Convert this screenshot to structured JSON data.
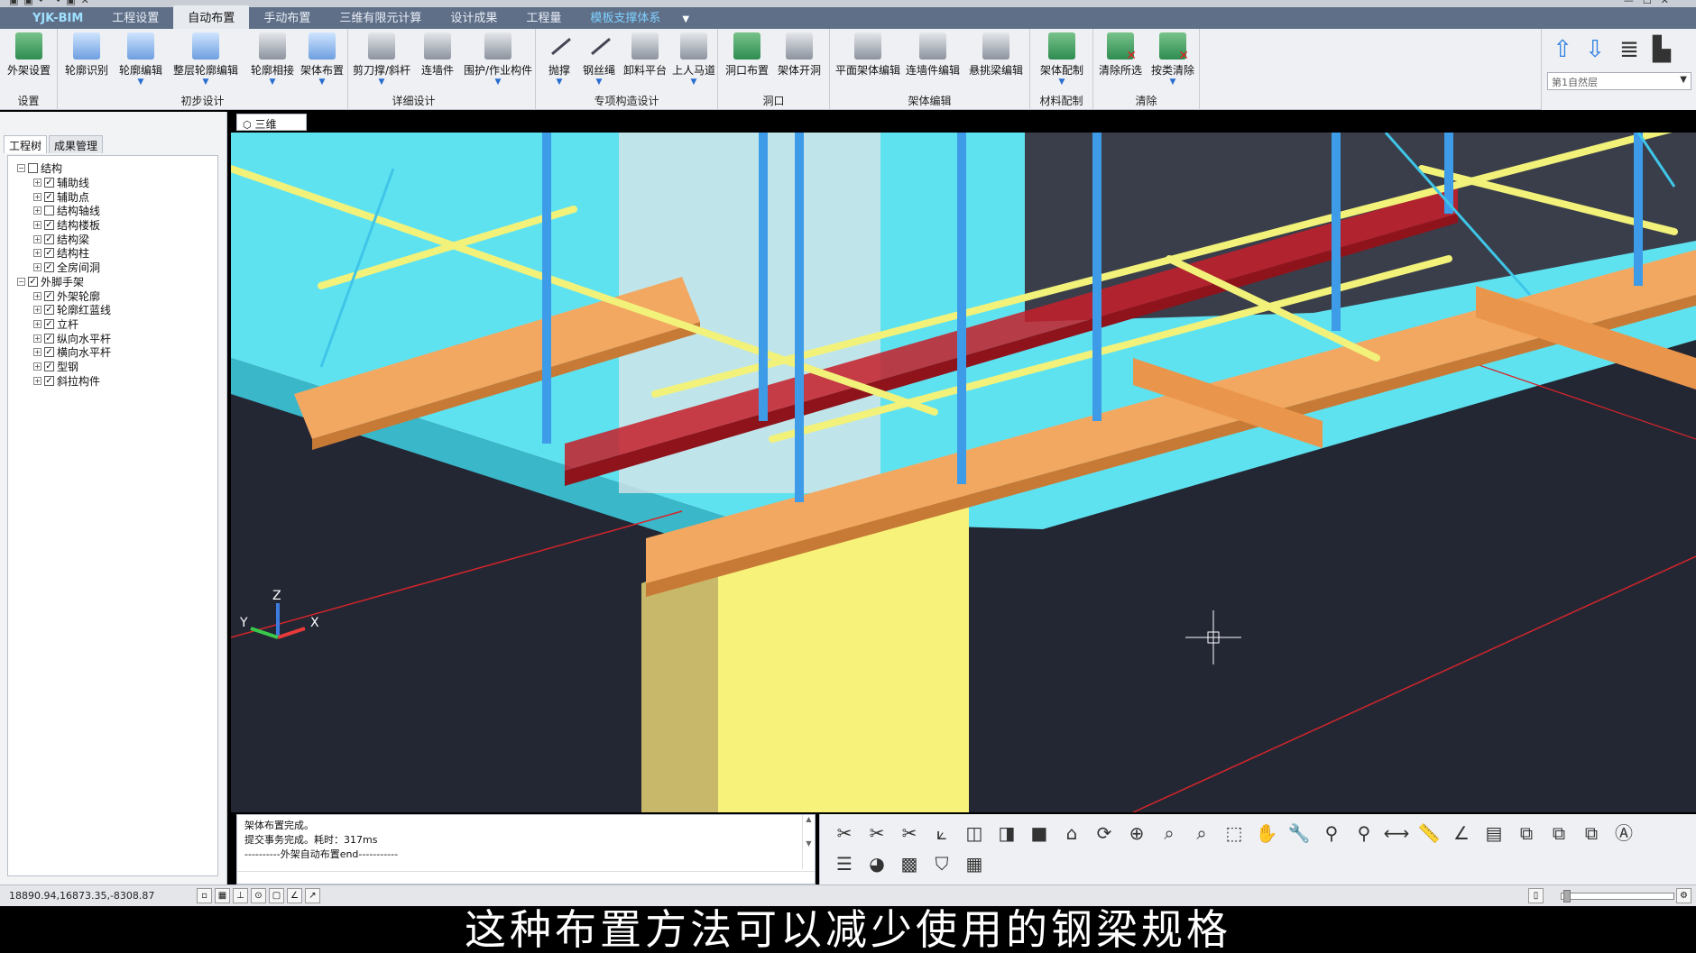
{
  "menubar": {
    "brand": "YJK-BIM",
    "tabs": [
      "工程设置",
      "自动布置",
      "手动布置",
      "三维有限元计算",
      "设计成果",
      "工程量",
      "模板支撑体系"
    ],
    "active_tab": "自动布置"
  },
  "ribbon": {
    "groups": [
      {
        "label": "设置",
        "buttons": [
          {
            "label": "外架设置"
          }
        ]
      },
      {
        "label": "初步设计",
        "buttons": [
          {
            "label": "轮廓识别"
          },
          {
            "label": "轮廓编辑"
          },
          {
            "label": "整层轮廓编辑"
          },
          {
            "label": "轮廓相接"
          }
        ]
      },
      {
        "label": "详细设计",
        "buttons": [
          {
            "label": "架体布置"
          },
          {
            "label": "剪刀撑/斜杆"
          },
          {
            "label": "连墙件"
          },
          {
            "label": "围护/作业构件"
          }
        ]
      },
      {
        "label": "专项构造设计",
        "buttons": [
          {
            "label": "抛撑"
          },
          {
            "label": "钢丝绳"
          },
          {
            "label": "卸料平台"
          },
          {
            "label": "上人马道"
          }
        ]
      },
      {
        "label": "洞口",
        "buttons": [
          {
            "label": "洞口布置"
          },
          {
            "label": "架体开洞"
          }
        ]
      },
      {
        "label": "架体编辑",
        "buttons": [
          {
            "label": "平面架体编辑"
          },
          {
            "label": "连墙件编辑"
          },
          {
            "label": "悬挑梁编辑"
          }
        ]
      },
      {
        "label": "材料配制",
        "buttons": [
          {
            "label": "架体配制"
          }
        ]
      },
      {
        "label": "清除",
        "buttons": [
          {
            "label": "清除所选"
          },
          {
            "label": "按类清除"
          }
        ]
      }
    ],
    "floor_select": "第1自然层"
  },
  "left_panel": {
    "tabs": [
      "工程树",
      "成果管理"
    ],
    "tree": [
      {
        "label": "结构",
        "level": 1,
        "checked": false,
        "expanded": true
      },
      {
        "label": "辅助线",
        "level": 2,
        "checked": true
      },
      {
        "label": "辅助点",
        "level": 2,
        "checked": true
      },
      {
        "label": "结构轴线",
        "level": 2,
        "checked": false
      },
      {
        "label": "结构楼板",
        "level": 2,
        "checked": true
      },
      {
        "label": "结构梁",
        "level": 2,
        "checked": true
      },
      {
        "label": "结构柱",
        "level": 2,
        "checked": true
      },
      {
        "label": "全房间洞",
        "level": 2,
        "checked": true
      },
      {
        "label": "外脚手架",
        "level": 1,
        "checked": true,
        "expanded": true
      },
      {
        "label": "外架轮廓",
        "level": 2,
        "checked": true
      },
      {
        "label": "轮廓红蓝线",
        "level": 2,
        "checked": true
      },
      {
        "label": "立杆",
        "level": 2,
        "checked": true
      },
      {
        "label": "纵向水平杆",
        "level": 2,
        "checked": true
      },
      {
        "label": "横向水平杆",
        "level": 2,
        "checked": true
      },
      {
        "label": "型钢",
        "level": 2,
        "checked": true
      },
      {
        "label": "斜拉构件",
        "level": 2,
        "checked": true
      }
    ]
  },
  "viewport": {
    "tab_label": "三维",
    "axis_labels": {
      "x": "X",
      "y": "Y",
      "z": "Z"
    }
  },
  "command_output": [
    "架体布置完成。",
    "提交事务完成。耗时：317ms",
    "----------外架自动布置end-----------"
  ],
  "status": {
    "coords": "18890.94,16873.35,-8308.87"
  },
  "subtitle": "这种布置方法可以减少使用的钢梁规格",
  "colors": {
    "menubar_bg": "#5f6f88",
    "viewport_bg": "#232734",
    "scaffold_pole": "#3d9be8",
    "slab_cyan": "#5fe2f0",
    "steel_beam_orange": "#f3a862",
    "steel_beam_red": "#c61f2a",
    "tube_yellow": "#f2f27a",
    "column_yellow": "#f7f27a"
  }
}
